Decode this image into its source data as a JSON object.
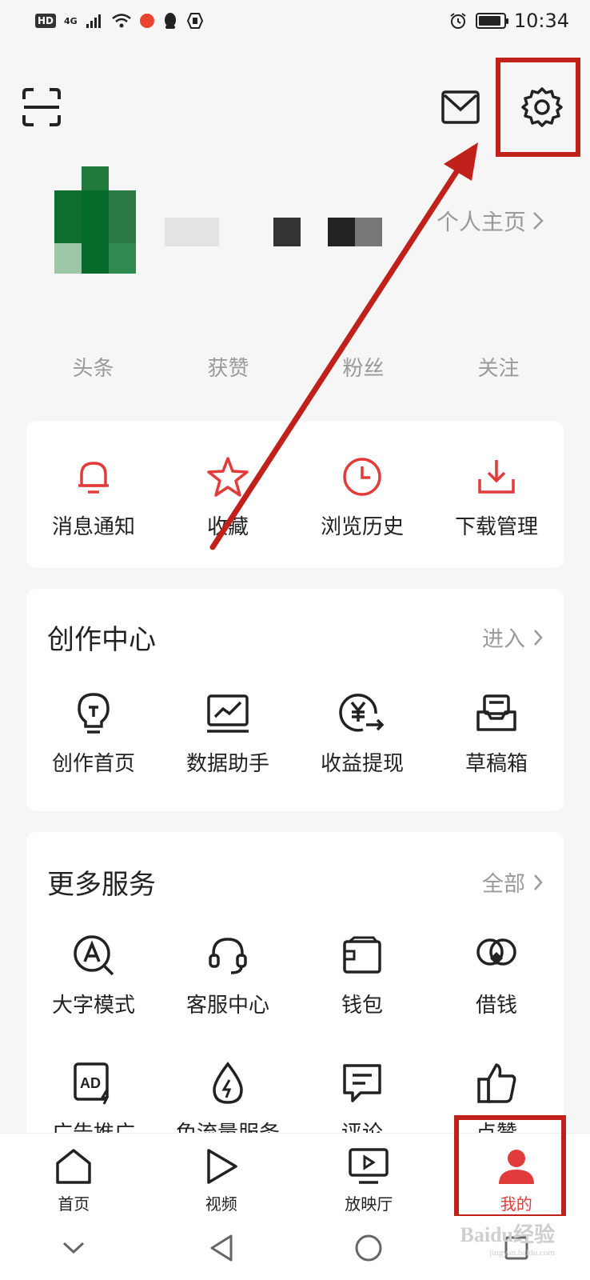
{
  "status_bar": {
    "hd_badge": "HD",
    "network": "4G",
    "time": "10:34"
  },
  "profile": {
    "home_link": "个人主页",
    "stats": [
      {
        "label": "头条"
      },
      {
        "label": "获赞"
      },
      {
        "label": "粉丝"
      },
      {
        "label": "关注"
      }
    ]
  },
  "quick_actions": [
    {
      "label": "消息通知",
      "icon": "bell-icon"
    },
    {
      "label": "收藏",
      "icon": "star-icon"
    },
    {
      "label": "浏览历史",
      "icon": "clock-icon"
    },
    {
      "label": "下载管理",
      "icon": "download-icon"
    }
  ],
  "creation_center": {
    "title": "创作中心",
    "more": "进入",
    "items": [
      {
        "label": "创作首页",
        "icon": "lightbulb-icon"
      },
      {
        "label": "数据助手",
        "icon": "chart-monitor-icon"
      },
      {
        "label": "收益提现",
        "icon": "yen-withdraw-icon"
      },
      {
        "label": "草稿箱",
        "icon": "draft-box-icon"
      }
    ]
  },
  "more_services": {
    "title": "更多服务",
    "more": "全部",
    "items": [
      {
        "label": "大字模式",
        "icon": "large-font-icon"
      },
      {
        "label": "客服中心",
        "icon": "headset-icon"
      },
      {
        "label": "钱包",
        "icon": "wallet-icon"
      },
      {
        "label": "借钱",
        "icon": "loan-icon"
      },
      {
        "label": "广告推广",
        "icon": "ad-icon"
      },
      {
        "label": "免流量服务",
        "icon": "data-free-icon"
      },
      {
        "label": "评论",
        "icon": "comment-icon"
      },
      {
        "label": "点赞",
        "icon": "thumbs-up-icon"
      }
    ]
  },
  "bottom_nav": [
    {
      "label": "首页",
      "icon": "home-icon"
    },
    {
      "label": "视频",
      "icon": "play-icon"
    },
    {
      "label": "放映厅",
      "icon": "screening-room-icon"
    },
    {
      "label": "我的",
      "icon": "user-icon",
      "active": true
    }
  ],
  "colors": {
    "accent_red": "#e23b3b",
    "annotation_red": "#c0211a",
    "background": "#f6f6f6"
  },
  "watermark": {
    "brand": "Baidu经验",
    "url": "jingyan.baidu.com"
  }
}
